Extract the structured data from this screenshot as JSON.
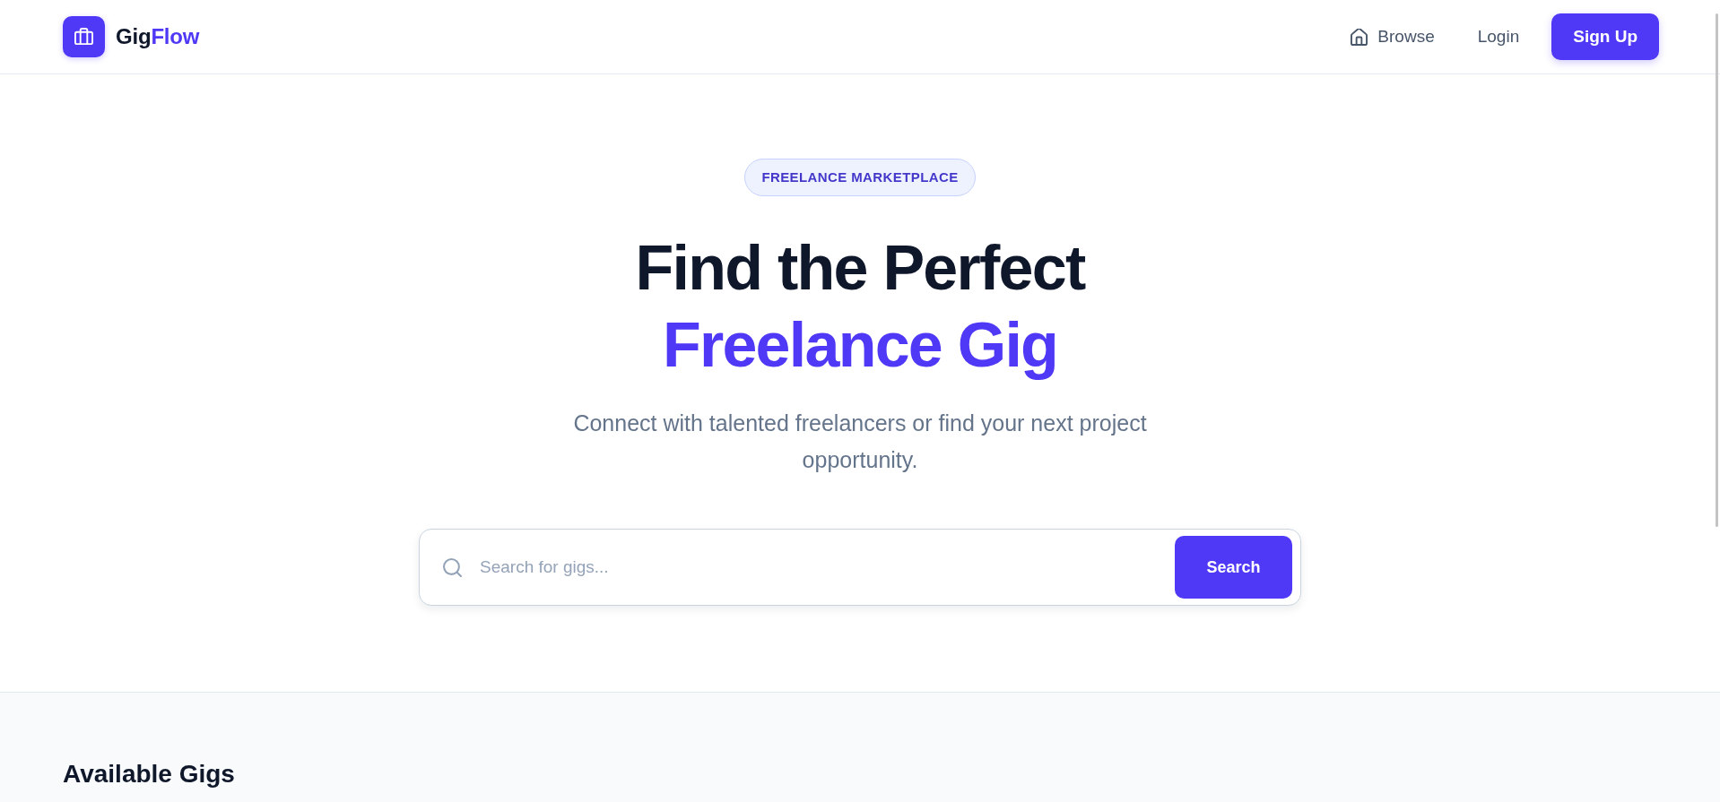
{
  "header": {
    "brand": {
      "text": "Gig",
      "accent": "Flow"
    },
    "nav": [
      {
        "kind": "icon-link",
        "label": "Browse"
      },
      {
        "kind": "link",
        "label": "Login"
      },
      {
        "kind": "button",
        "label": "Sign Up"
      }
    ]
  },
  "hero": {
    "badge": "FREELANCE MARKETPLACE",
    "title": "Find the Perfect",
    "title_accent": "Freelance Gig",
    "subtitle": "Connect with talented freelancers or find your next project opportunity.",
    "search": {
      "placeholder": "Search for gigs...",
      "button": "Search"
    }
  },
  "gigs": {
    "title": "Available Gigs"
  }
}
